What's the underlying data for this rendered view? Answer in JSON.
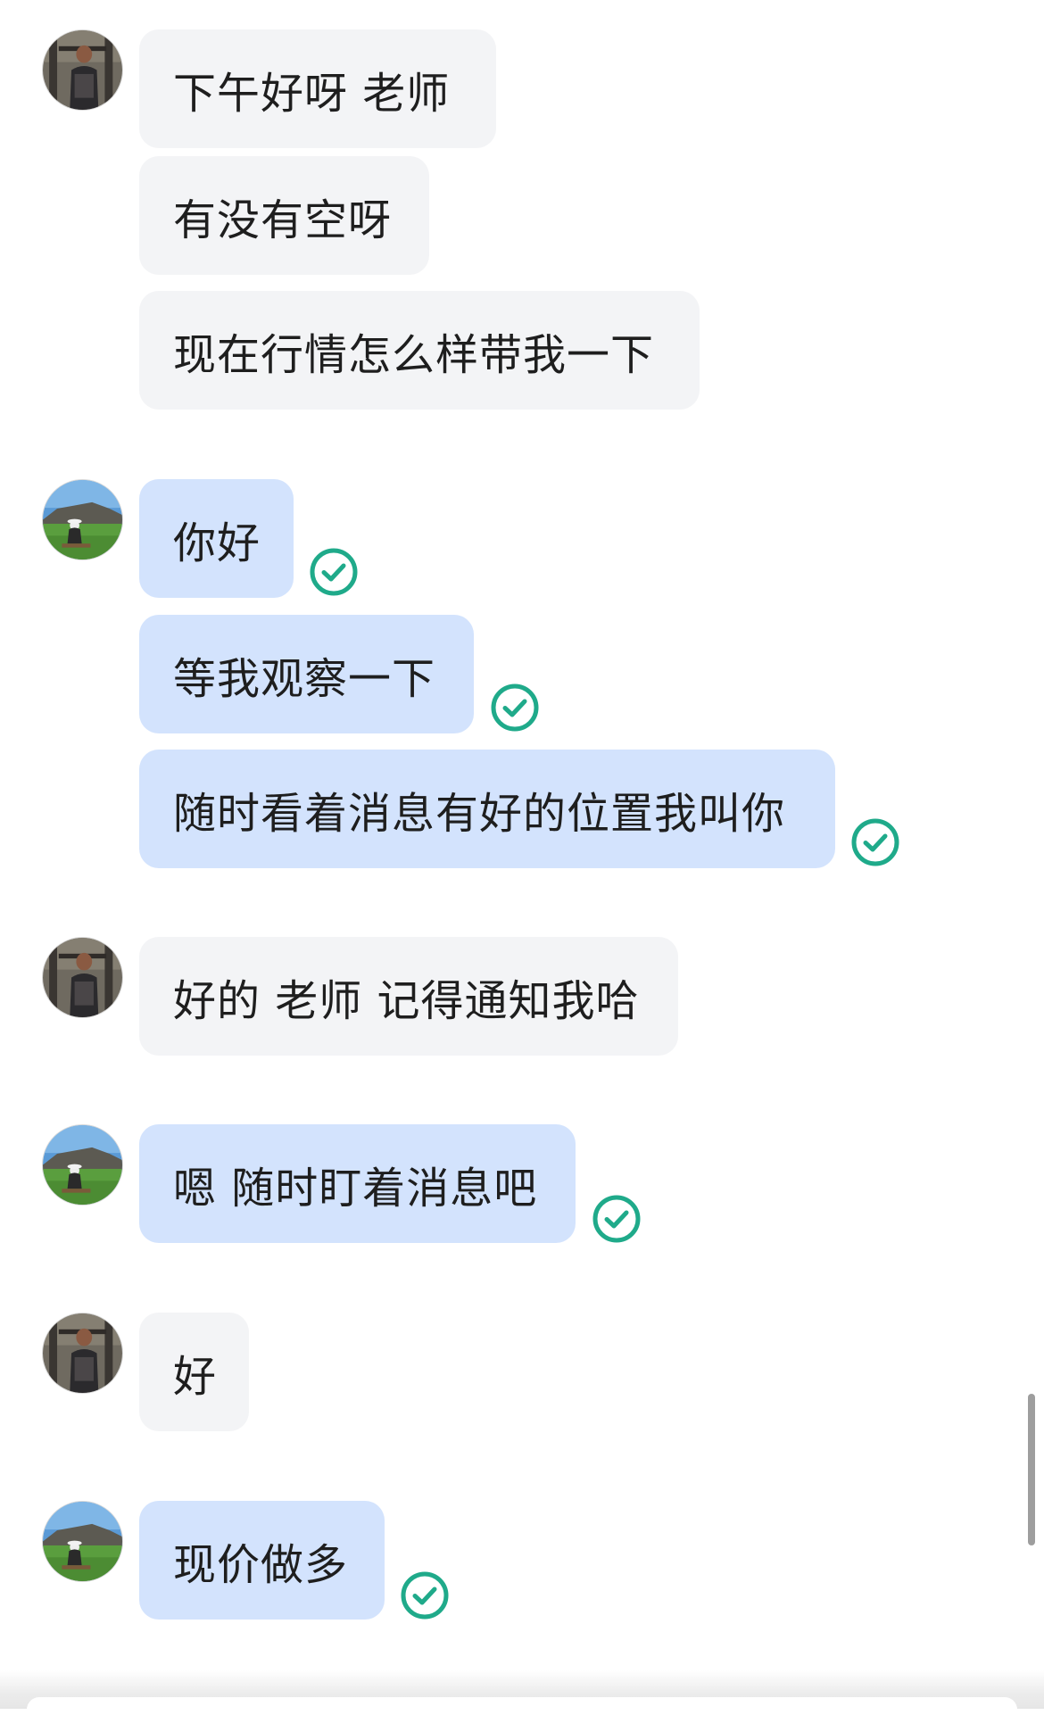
{
  "conversation": {
    "messages": [
      {
        "direction": "in",
        "text": "下午好呀 老师"
      },
      {
        "direction": "in",
        "text": "有没有空呀"
      },
      {
        "direction": "in",
        "text": "现在行情怎么样带我一下"
      },
      {
        "direction": "out",
        "text": "你好"
      },
      {
        "direction": "out",
        "text": "等我观察一下"
      },
      {
        "direction": "out",
        "text": "随时看着消息有好的位置我叫你"
      },
      {
        "direction": "in",
        "text": "好的 老师 记得通知我哈"
      },
      {
        "direction": "out",
        "text": "嗯 随时盯着消息吧"
      },
      {
        "direction": "in",
        "text": "好"
      },
      {
        "direction": "out",
        "text": "现价做多"
      }
    ]
  },
  "colors": {
    "incoming_bubble": "#f3f4f6",
    "outgoing_bubble": "#d3e3fd",
    "read_check": "#1faa8a",
    "text": "#1e1e1e"
  },
  "icons": {
    "read_receipt": "check-circle-icon",
    "incoming_avatar": "user-avatar-icon",
    "outgoing_avatar": "contact-avatar-icon"
  }
}
